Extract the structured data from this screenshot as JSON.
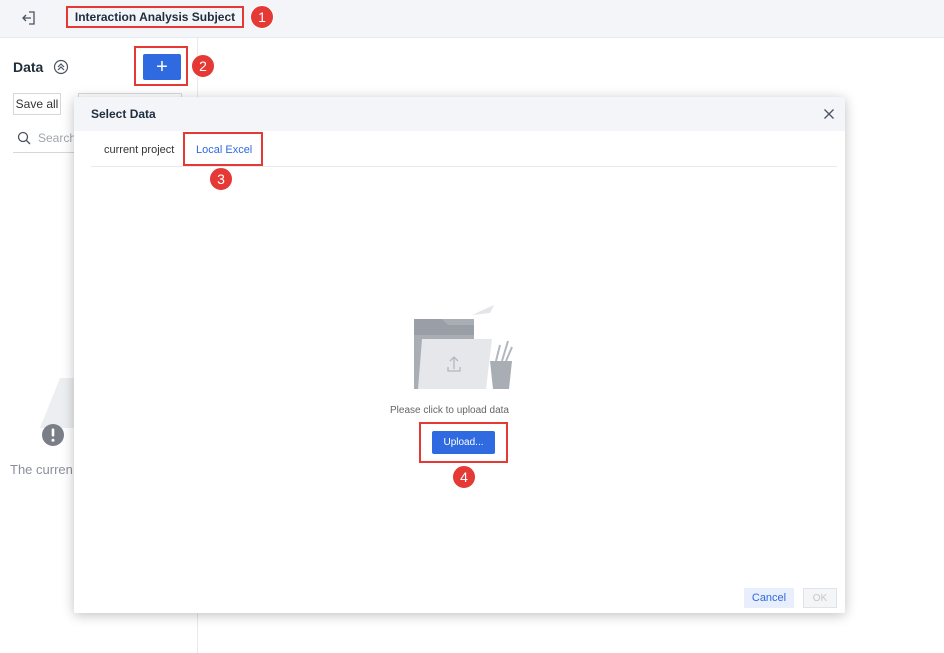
{
  "header": {
    "title": "Interaction Analysis Subject",
    "exit_icon": "exit-icon"
  },
  "left_panel": {
    "title": "Data",
    "add_label": "+",
    "save_all_label": "Save all",
    "search_placeholder": "Search",
    "empty_text": "The curren"
  },
  "modal": {
    "title": "Select Data",
    "tabs": [
      {
        "label": "current project",
        "active": false
      },
      {
        "label": "Local Excel",
        "active": true
      }
    ],
    "upload_hint": "Please click to upload data",
    "upload_label": "Upload...",
    "cancel_label": "Cancel",
    "ok_label": "OK"
  },
  "annotations": [
    "1",
    "2",
    "3",
    "4"
  ],
  "colors": {
    "accent": "#2f6ae0",
    "highlight": "#e53935",
    "header_bg": "#f3f5f8"
  }
}
